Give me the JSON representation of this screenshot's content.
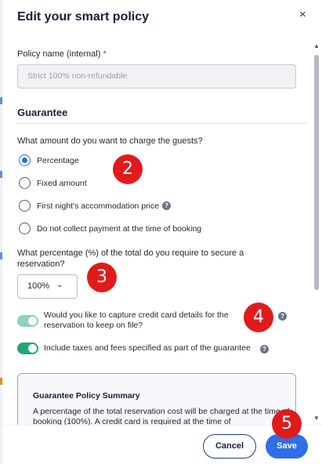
{
  "dialog": {
    "title": "Edit your smart policy",
    "close_glyph": "×"
  },
  "policy_name": {
    "label": "Policy name (internal)",
    "required_mark": "*",
    "placeholder": "Strict 100% non-refundable"
  },
  "guarantee": {
    "section_title": "Guarantee",
    "question": "What amount do you want to charge the guests?",
    "options": [
      {
        "label": "Percentage",
        "selected": true
      },
      {
        "label": "Fixed amount",
        "selected": false
      },
      {
        "label": "First night's accommodation price",
        "selected": false,
        "help": true
      },
      {
        "label": "Do not collect payment at the time of booking",
        "selected": false
      }
    ],
    "percentage_question": "What percentage (%) of the total do you require to secure a reservation?",
    "percentage_value": "100%",
    "toggles": [
      {
        "label": "Would you like to capture credit card details for the reservation to keep on file?",
        "on": true,
        "help": true
      },
      {
        "label": "Include taxes and fees specified as part of the guarantee",
        "on": true,
        "help": true
      }
    ]
  },
  "summary": {
    "title": "Guarantee Policy Summary",
    "text": "A percentage of the total reservation cost will be charged at the time of booking (100%). A credit card is required at the time of"
  },
  "footer": {
    "cancel_label": "Cancel",
    "save_label": "Save"
  },
  "annotations": [
    "2",
    "3",
    "4",
    "5"
  ],
  "colors": {
    "accent": "#2f6ee6",
    "toggle_on": "#23a37b",
    "badge": "#e01b1b"
  }
}
